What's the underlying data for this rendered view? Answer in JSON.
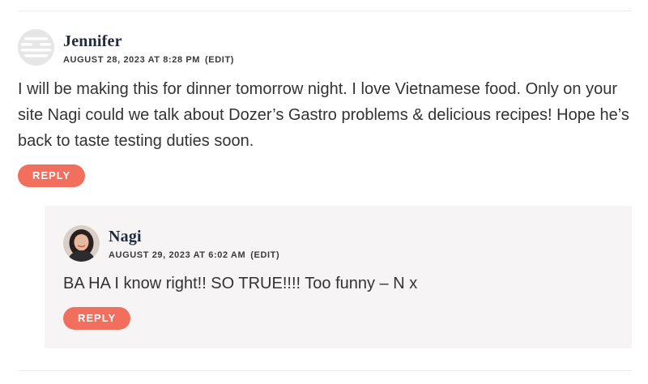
{
  "comments": [
    {
      "author": "Jennifer",
      "date": "AUGUST 28, 2023 AT 8:28 PM",
      "edit_label": "(EDIT)",
      "text": "I will be making this for dinner tomorrow night. I love Vietnamese food. Only on your site Nagi could we talk about Dozer’s Gastro problems & delicious recipes! Hope he’s back to taste testing duties soon.",
      "reply_label": "REPLY",
      "avatar_icon": "default-gravatar-icon"
    },
    {
      "author": "Nagi",
      "date": "AUGUST 29, 2023 AT 6:02 AM",
      "edit_label": "(EDIT)",
      "text": "BA HA I know right!! SO TRUE!!!! Too funny – N x",
      "reply_label": "REPLY",
      "avatar_icon": "author-photo"
    }
  ],
  "colors": {
    "reply_button": "#f26f5e",
    "author_name": "#1f2b3c",
    "reply_background": "#f6f4f5"
  }
}
